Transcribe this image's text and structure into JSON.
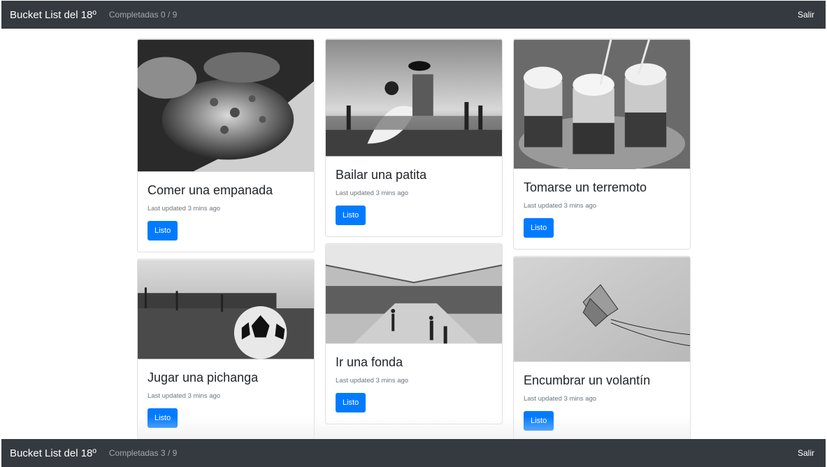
{
  "top_navbar": {
    "brand": "Bucket List del 18º",
    "progress": "Completadas 0 / 9",
    "logout": "Salir"
  },
  "bottom_navbar": {
    "brand": "Bucket List del 18º",
    "progress": "Completadas 3 / 9",
    "logout": "Salir"
  },
  "cards": [
    {
      "title": "Comer una empanada",
      "meta": "Last updated 3 mins ago",
      "button": "Listo"
    },
    {
      "title": "Bailar una patita",
      "meta": "Last updated 3 mins ago",
      "button": "Listo"
    },
    {
      "title": "Tomarse un terremoto",
      "meta": "Last updated 3 mins ago",
      "button": "Listo"
    },
    {
      "title": "Jugar una pichanga",
      "meta": "Last updated 3 mins ago",
      "button": "Listo"
    },
    {
      "title": "Ir una fonda",
      "meta": "Last updated 3 mins ago",
      "button": "Listo"
    },
    {
      "title": "Encumbrar un volantín",
      "meta": "Last updated 3 mins ago",
      "button": "Listo"
    }
  ],
  "colors": {
    "navbar": "#343a40",
    "button": "#007bff"
  }
}
